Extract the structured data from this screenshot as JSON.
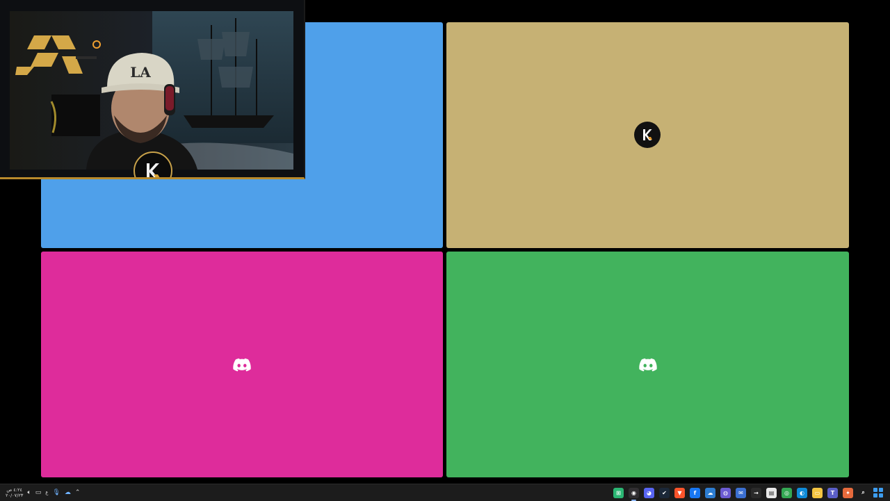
{
  "call_grid": {
    "tiles": [
      {
        "id": "blue",
        "color": "#4fa0ea",
        "content": "webcam-tile"
      },
      {
        "id": "tan",
        "color": "#c6b174",
        "content": "k-logo-avatar"
      },
      {
        "id": "pink",
        "color": "#de2c9b",
        "content": "discord-icon"
      },
      {
        "id": "green",
        "color": "#42b35d",
        "content": "discord-icon"
      }
    ]
  },
  "webcam_overlay": {
    "cap_text": "LA",
    "frame_color": "#b88a2c"
  },
  "taskbar": {
    "clock_time": "٤:٢٤ ص",
    "clock_date": "٢٠/٠٧/٢٣",
    "ime_label": "ع",
    "tray_icons": [
      "volume-icon",
      "network-icon",
      "mic-icon",
      "onedrive-icon",
      "chevron-up-icon"
    ],
    "pinned_apps": [
      {
        "name": "app-green-icon",
        "color": "#2bb673",
        "glyph": "⊞"
      },
      {
        "name": "obs-icon",
        "color": "#302e31",
        "glyph": "◉",
        "active": true
      },
      {
        "name": "discord-app-icon",
        "color": "#5865f2",
        "glyph": "◕"
      },
      {
        "name": "steam-icon",
        "color": "#1b2838",
        "glyph": "✔"
      },
      {
        "name": "brave-icon",
        "color": "#fb542b",
        "glyph": "▼"
      },
      {
        "name": "facebook-icon",
        "color": "#1877f2",
        "glyph": "f"
      },
      {
        "name": "cloud-app-icon",
        "color": "#2d7dd2",
        "glyph": "☁"
      },
      {
        "name": "messenger-icon",
        "color": "#6b5bd2",
        "glyph": "◍"
      },
      {
        "name": "mail-icon",
        "color": "#3b6fd1",
        "glyph": "✉"
      },
      {
        "name": "arrow-app-icon",
        "color": "#2a2a2a",
        "glyph": "→"
      },
      {
        "name": "notepad-icon",
        "color": "#e8e8e8",
        "glyph": "▤"
      },
      {
        "name": "chrome-icon",
        "color": "#34a853",
        "glyph": "◎"
      },
      {
        "name": "edge-icon",
        "color": "#0f8bd8",
        "glyph": "◐"
      },
      {
        "name": "folder-icon",
        "color": "#f4c542",
        "glyph": "▭"
      },
      {
        "name": "teams-icon",
        "color": "#5b5fc7",
        "glyph": "T"
      },
      {
        "name": "copilot-icon",
        "color": "#e66a3c",
        "glyph": "✦"
      },
      {
        "name": "search-icon",
        "color": "#1c1c1c",
        "glyph": "⌕"
      }
    ]
  }
}
